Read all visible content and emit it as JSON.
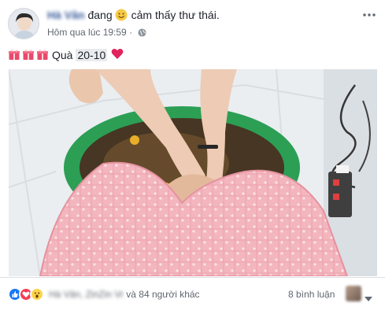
{
  "header": {
    "author_name": "Hà Vân",
    "verb": "đang",
    "feeling_emoji": "smiley-icon",
    "feeling_text": "cảm thấy thư thái.",
    "timestamp": "Hôm qua lúc 19:59",
    "privacy_icon": "globe-icon",
    "more_icon": "more-dots-icon"
  },
  "caption": {
    "gift_icons": [
      "gift-icon",
      "gift-icon",
      "gift-icon"
    ],
    "text": "Quà",
    "tag": "20-10",
    "end_icon": "heart-icon"
  },
  "footer": {
    "reaction_icons": [
      "like-icon",
      "love-icon",
      "wow-icon"
    ],
    "reactor_names": "Hà Vân, ZinZin Vr",
    "reactor_suffix": "và 84 người khác",
    "comments": "8 bình luận",
    "audience_icon": "chevron-down-icon"
  },
  "colors": {
    "link": "#365899",
    "meta_text": "#616770",
    "like_blue": "#1877f2",
    "love_red": "#f33e58",
    "wow_yellow": "#fcd34d",
    "tag_bg": "#e9ebee"
  }
}
